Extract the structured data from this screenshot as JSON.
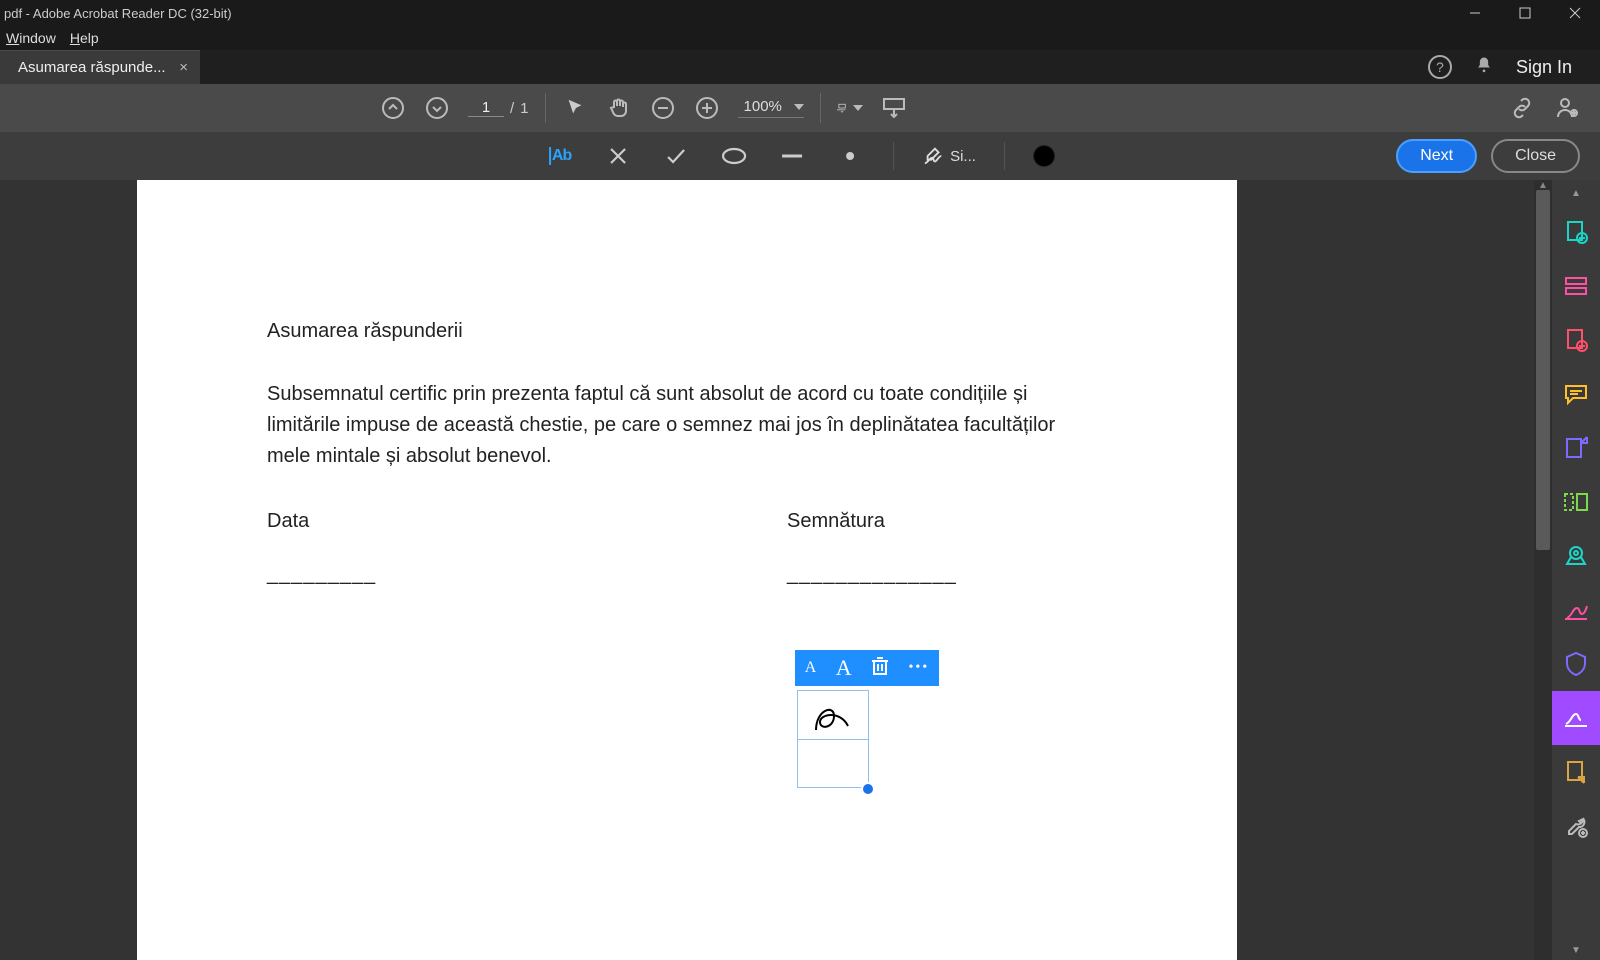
{
  "window": {
    "title": "pdf - Adobe Acrobat Reader DC (32-bit)"
  },
  "menu": {
    "window": "Window",
    "help": "Help"
  },
  "tab": {
    "label": "Asumarea răspunde..."
  },
  "header": {
    "sign_in": "Sign In"
  },
  "toolbar": {
    "page_current": "1",
    "page_sep": "/",
    "page_total": "1",
    "zoom": "100%"
  },
  "fillsign": {
    "ab_label": "Ab",
    "sign_label": "Si...",
    "next": "Next",
    "close": "Close"
  },
  "document": {
    "title": "Asumarea răspunderii",
    "body": "Subsemnatul certific prin prezenta faptul că sunt absolut de acord cu toate condițiile și limitările impuse de această chestie, pe care o semnez mai jos în deplinătatea facultăților mele mintale și absolut benevol.",
    "date_label": "Data",
    "sig_label": "Semnătura",
    "line1": "_________",
    "line2": "______________"
  },
  "selection_toolbar": {
    "small_a": "A",
    "big_a": "A",
    "more": "•••"
  }
}
